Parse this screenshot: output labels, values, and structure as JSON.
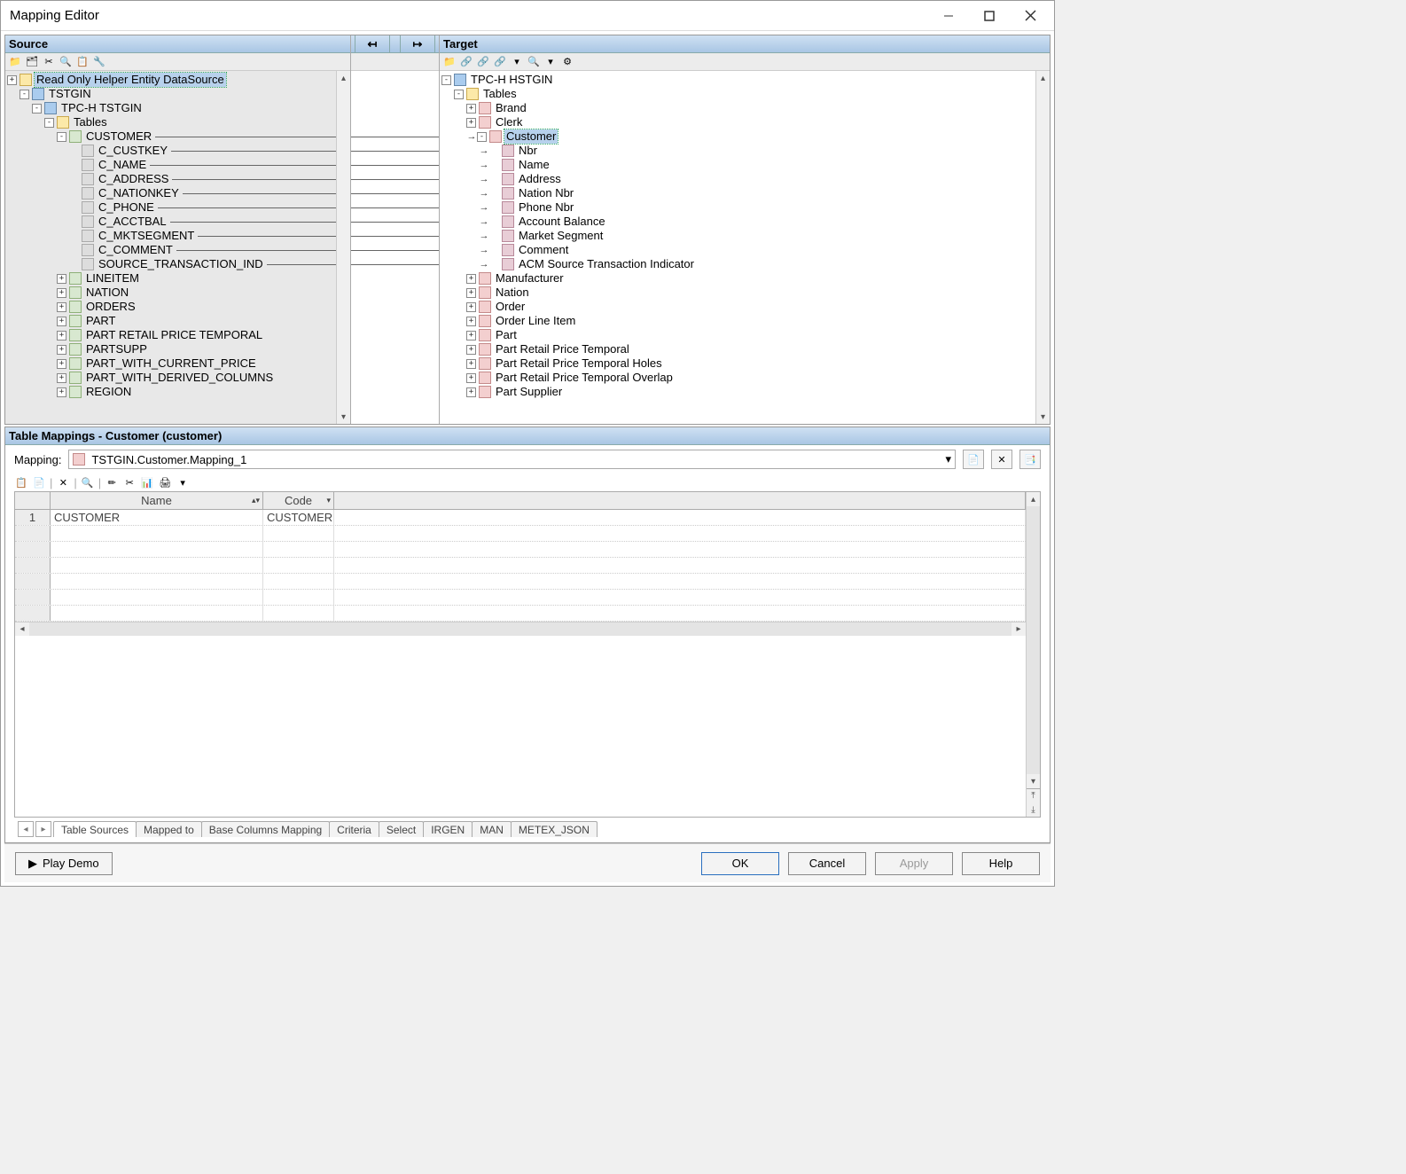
{
  "window": {
    "title": "Mapping Editor"
  },
  "source": {
    "header": "Source",
    "root_helper": "Read Only Helper Entity DataSource",
    "datasource": "TSTGIN",
    "schema": "TPC-H TSTGIN",
    "tables_label": "Tables",
    "customer_table": "CUSTOMER",
    "customer_cols": [
      "C_CUSTKEY",
      "C_NAME",
      "C_ADDRESS",
      "C_NATIONKEY",
      "C_PHONE",
      "C_ACCTBAL",
      "C_MKTSEGMENT",
      "C_COMMENT",
      "SOURCE_TRANSACTION_IND"
    ],
    "other_tables": [
      "LINEITEM",
      "NATION",
      "ORDERS",
      "PART",
      "PART RETAIL PRICE TEMPORAL",
      "PARTSUPP",
      "PART_WITH_CURRENT_PRICE",
      "PART_WITH_DERIVED_COLUMNS",
      "REGION"
    ]
  },
  "target": {
    "header": "Target",
    "schema": "TPC-H HSTGIN",
    "tables_label": "Tables",
    "before_customer": [
      "Brand",
      "Clerk"
    ],
    "customer_entity": "Customer",
    "customer_attrs": [
      "Nbr",
      "Name",
      "Address",
      "Nation Nbr",
      "Phone Nbr",
      "Account Balance",
      "Market Segment",
      "Comment",
      "ACM Source Transaction Indicator"
    ],
    "after_customer": [
      "Manufacturer",
      "Nation",
      "Order",
      "Order Line Item",
      "Part",
      "Part Retail Price Temporal",
      "Part Retail Price Temporal Holes",
      "Part Retail Price Temporal Overlap",
      "Part Supplier"
    ]
  },
  "mappings_panel": {
    "header": "Table Mappings - Customer (customer)",
    "mapping_label": "Mapping:",
    "mapping_value": "TSTGIN.Customer.Mapping_1",
    "grid_headers": {
      "name": "Name",
      "code": "Code"
    },
    "rows": [
      {
        "num": "1",
        "name": "CUSTOMER",
        "code": "CUSTOMER"
      }
    ],
    "tabs": [
      "Table Sources",
      "Mapped to",
      "Base Columns Mapping",
      "Criteria",
      "Select",
      "IRGEN",
      "MAN",
      "METEX_JSON"
    ]
  },
  "footer": {
    "play": "Play Demo",
    "ok": "OK",
    "cancel": "Cancel",
    "apply": "Apply",
    "help": "Help"
  }
}
